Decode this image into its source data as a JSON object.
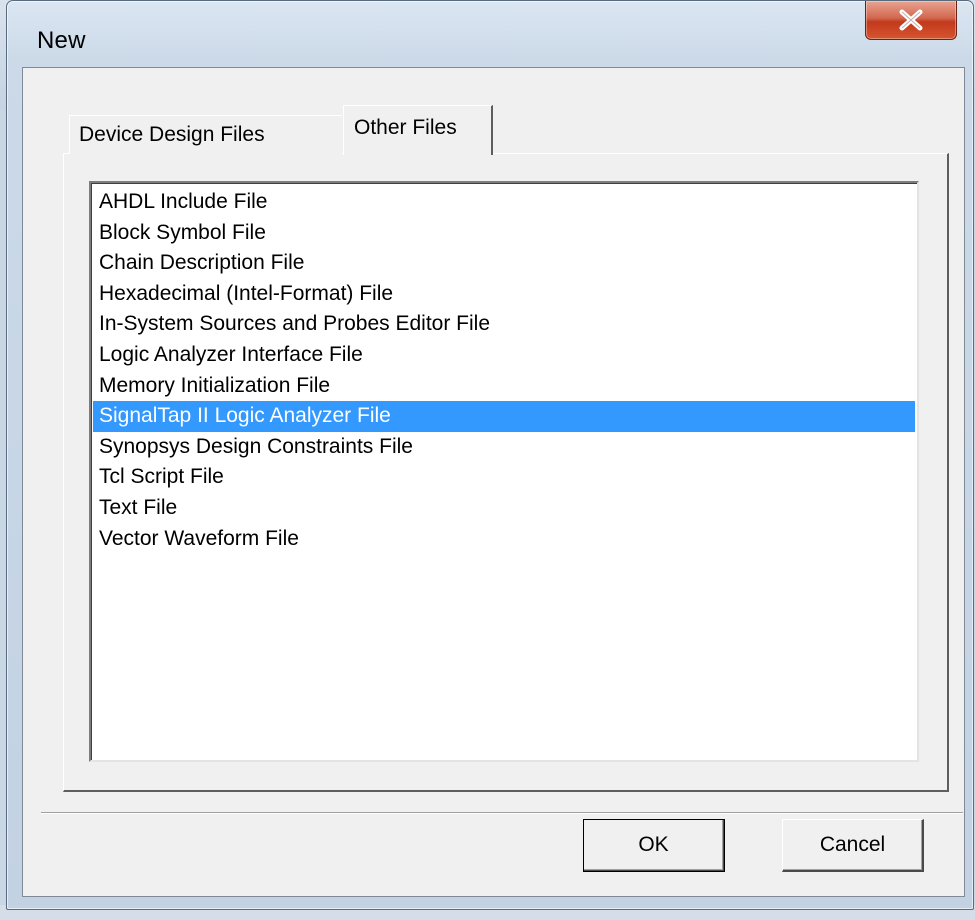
{
  "window": {
    "title": "New",
    "close_glyph": "X"
  },
  "tabs": [
    {
      "label": "Device Design Files",
      "active": false
    },
    {
      "label": "Other Files",
      "active": true
    }
  ],
  "file_list": {
    "items": [
      "AHDL Include File",
      "Block Symbol File",
      "Chain Description File",
      "Hexadecimal (Intel-Format) File",
      "In-System Sources and Probes Editor File",
      "Logic Analyzer Interface File",
      "Memory Initialization File",
      "SignalTap II Logic Analyzer File",
      "Synopsys Design Constraints File",
      "Tcl Script File",
      "Text File",
      "Vector Waveform File"
    ],
    "selected_index": 7
  },
  "buttons": {
    "ok_label": "OK",
    "cancel_label": "Cancel"
  },
  "colors": {
    "selection": "#3399ff",
    "close_button": "#c2391c"
  },
  "icons": {
    "close": "close-icon"
  }
}
